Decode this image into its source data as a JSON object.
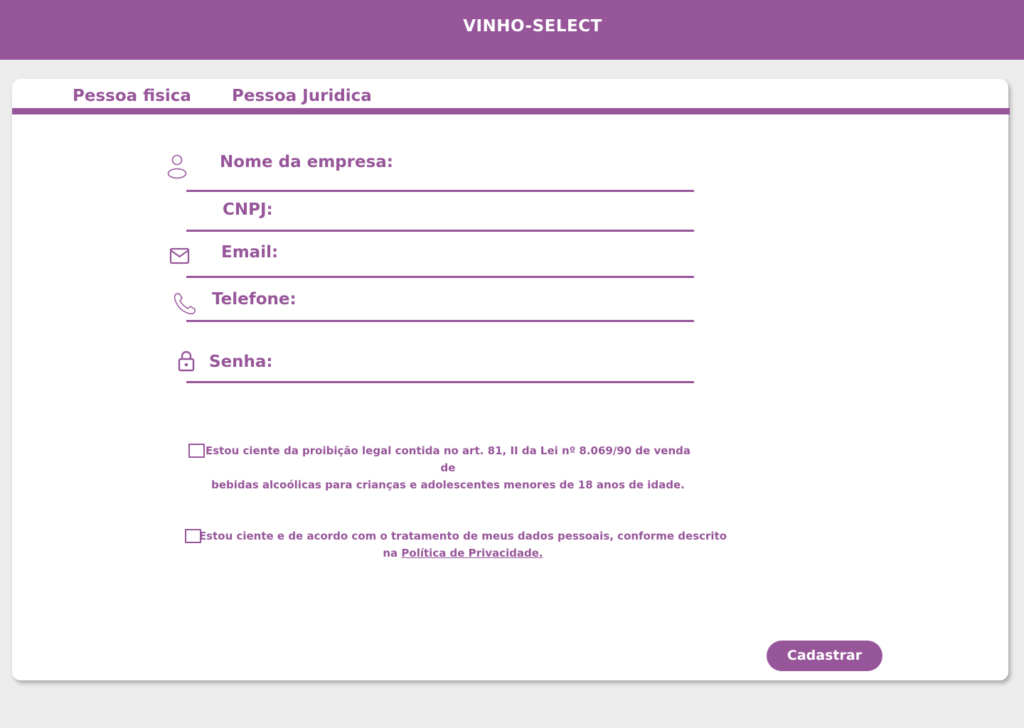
{
  "header": {
    "title": "VINHO-SELECT"
  },
  "tabs": [
    {
      "label": "Pessoa fisica"
    },
    {
      "label": "Pessoa Juridica"
    }
  ],
  "form": {
    "fields": {
      "company_name": {
        "label": "Nome da empresa:",
        "icon": "user-icon",
        "value": ""
      },
      "cnpj": {
        "label": "CNPJ:",
        "value": ""
      },
      "email": {
        "label": "Email:",
        "icon": "mail-icon",
        "value": ""
      },
      "phone": {
        "label": "Telefone:",
        "icon": "phone-icon",
        "value": ""
      },
      "password": {
        "label": "Senha:",
        "icon": "lock-icon",
        "value": ""
      }
    },
    "consents": {
      "legal": {
        "line1": "Estou ciente da proibição legal contida no art. 81, II da Lei nº 8.069/90 de venda de",
        "line2": "bebidas alcoólicas para crianças e adolescentes menores de 18 anos de idade.",
        "checked": false
      },
      "privacy": {
        "line1": "Estou ciente e de acordo com o tratamento de meus dados pessoais, conforme descrito",
        "line2_prefix": "na",
        "link_text": "Política de Privacidade.",
        "checked": false
      }
    },
    "submit_label": "Cadastrar"
  },
  "colors": {
    "primary": "#97569a",
    "background": "#ececec",
    "card": "#ffffff"
  }
}
